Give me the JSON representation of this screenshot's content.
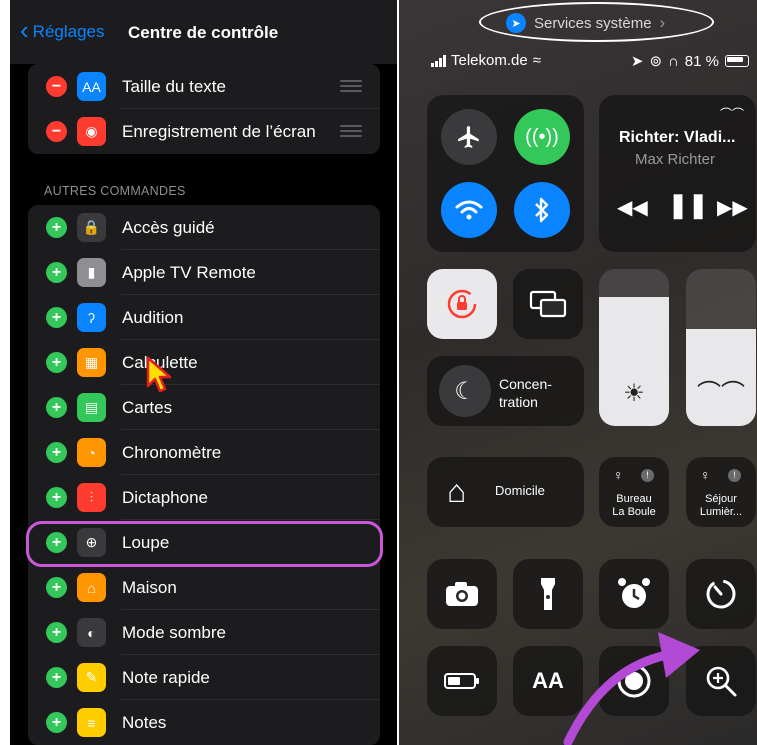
{
  "settings": {
    "back_label": "Réglages",
    "title": "Centre de contrôle",
    "included": [
      {
        "label": "Taille du texte",
        "icon_text": "AA",
        "icon": "text-size-icon",
        "color": "#0a84ff"
      },
      {
        "label": "Enregistrement de l’écran",
        "icon_text": "◉",
        "icon": "screen-recording-icon",
        "color": "#ff3b30"
      }
    ],
    "more_header": "AUTRES COMMANDES",
    "more": [
      {
        "label": "Accès guidé",
        "icon_text": "🔒",
        "icon": "guided-access-icon",
        "color": "#3a3a3c"
      },
      {
        "label": "Apple TV Remote",
        "icon_text": "▮",
        "icon": "tv-remote-icon",
        "color": "#8e8e93"
      },
      {
        "label": "Audition",
        "icon_text": "ʔ",
        "icon": "hearing-icon",
        "color": "#0a84ff"
      },
      {
        "label": "Calculette",
        "icon_text": "▦",
        "icon": "calculator-icon",
        "color": "#ff9500"
      },
      {
        "label": "Cartes",
        "icon_text": "▤",
        "icon": "wallet-icon",
        "color": "#34c759"
      },
      {
        "label": "Chronomètre",
        "icon_text": "◔",
        "icon": "stopwatch-icon",
        "color": "#ff9500"
      },
      {
        "label": "Dictaphone",
        "icon_text": "⫶",
        "icon": "voice-memos-icon",
        "color": "#ff3b30"
      },
      {
        "label": "Loupe",
        "icon_text": "⊕",
        "icon": "magnifier-icon",
        "color": "#3a3a3c"
      },
      {
        "label": "Maison",
        "icon_text": "⌂",
        "icon": "home-icon",
        "color": "#ff9500"
      },
      {
        "label": "Mode sombre",
        "icon_text": "◐",
        "icon": "dark-mode-icon",
        "color": "#3a3a3c"
      },
      {
        "label": "Note rapide",
        "icon_text": "✎",
        "icon": "quick-note-icon",
        "color": "#ffcc00"
      },
      {
        "label": "Notes",
        "icon_text": "≡",
        "icon": "notes-icon",
        "color": "#ffcc00"
      }
    ]
  },
  "control_center": {
    "services_label": "Services système",
    "carrier": "Telekom.de",
    "battery": "81 %",
    "music_title": "Richter: Vladi...",
    "music_artist": "Max Richter",
    "focus_label_1": "Concen-",
    "focus_label_2": "tration",
    "home_label": "Domicile",
    "light1_line1": "Bureau",
    "light1_line2": "La Boule",
    "light2_line1": "Séjour",
    "light2_line2": "Lumièr...",
    "brightness_level": 0.82,
    "volume_level": 0.62,
    "text_size_glyph": "AA"
  }
}
